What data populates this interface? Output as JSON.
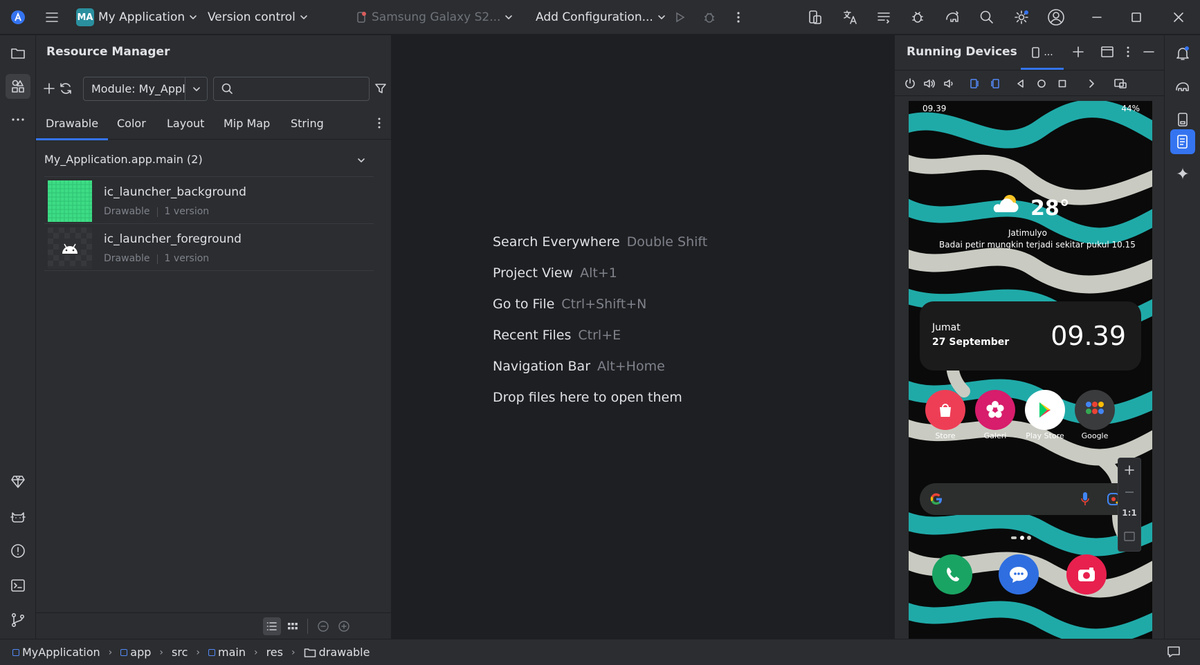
{
  "titlebar": {
    "project_badge": "MA",
    "project_name": "My Application",
    "version_control": "Version control",
    "device": "Samsung Galaxy S2...",
    "run_config": "Add Configuration..."
  },
  "resource_manager": {
    "title": "Resource Manager",
    "module_select": "Module: My_Appli",
    "search_placeholder": "",
    "tabs": [
      "Drawable",
      "Color",
      "Layout",
      "Mip Map",
      "String"
    ],
    "active_tab": "Drawable",
    "group_header": "My_Application.app.main (2)",
    "items": [
      {
        "name": "ic_launcher_background",
        "type": "Drawable",
        "versions": "1 version"
      },
      {
        "name": "ic_launcher_foreground",
        "type": "Drawable",
        "versions": "1 version"
      }
    ]
  },
  "editor_hints": [
    {
      "action": "Search Everywhere",
      "shortcut": "Double Shift"
    },
    {
      "action": "Project View",
      "shortcut": "Alt+1"
    },
    {
      "action": "Go to File",
      "shortcut": "Ctrl+Shift+N"
    },
    {
      "action": "Recent Files",
      "shortcut": "Ctrl+E"
    },
    {
      "action": "Navigation Bar",
      "shortcut": "Alt+Home"
    },
    {
      "action": "Drop files here to open them",
      "shortcut": ""
    }
  ],
  "running_devices": {
    "title": "Running Devices",
    "tab_label": "...",
    "phone": {
      "status_time": "09.39",
      "status_battery": "44%",
      "weather_temp": "28°",
      "weather_location": "Jatimulyo",
      "weather_message": "Badai petir mungkin terjadi sekitar pukul 10.15",
      "clock_day": "Jumat",
      "clock_date": "27 September",
      "clock_time": "09.39",
      "apps": [
        "Store",
        "Galeri",
        "Play Store",
        "Google"
      ]
    },
    "zoom_ratio": "1:1"
  },
  "statusbar": {
    "breadcrumb": [
      "MyApplication",
      "app",
      "src",
      "main",
      "res",
      "drawable"
    ]
  },
  "colors": {
    "accent": "#3574f0",
    "panel_bg": "#2b2d30",
    "editor_bg": "#1e1f22"
  }
}
